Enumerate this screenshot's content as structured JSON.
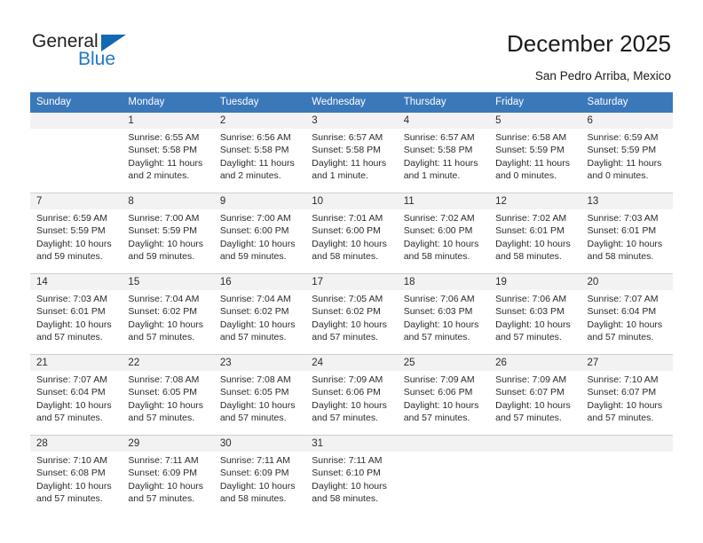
{
  "brand": {
    "word_one": "General",
    "word_two": "Blue",
    "accent_color": "#1268b3",
    "text_color": "#222222"
  },
  "header": {
    "title": "December 2025",
    "location": "San Pedro Arriba, Mexico"
  },
  "calendar": {
    "header_bg": "#3a78ba",
    "header_text_color": "#ffffff",
    "daynum_band_bg": "#f2f2f2",
    "weekday_headers": [
      "Sunday",
      "Monday",
      "Tuesday",
      "Wednesday",
      "Thursday",
      "Friday",
      "Saturday"
    ],
    "weeks": [
      [
        {
          "day": "",
          "sunrise": "",
          "sunset": "",
          "daylight_1": "",
          "daylight_2": ""
        },
        {
          "day": "1",
          "sunrise": "Sunrise: 6:55 AM",
          "sunset": "Sunset: 5:58 PM",
          "daylight_1": "Daylight: 11 hours",
          "daylight_2": "and 2 minutes."
        },
        {
          "day": "2",
          "sunrise": "Sunrise: 6:56 AM",
          "sunset": "Sunset: 5:58 PM",
          "daylight_1": "Daylight: 11 hours",
          "daylight_2": "and 2 minutes."
        },
        {
          "day": "3",
          "sunrise": "Sunrise: 6:57 AM",
          "sunset": "Sunset: 5:58 PM",
          "daylight_1": "Daylight: 11 hours",
          "daylight_2": "and 1 minute."
        },
        {
          "day": "4",
          "sunrise": "Sunrise: 6:57 AM",
          "sunset": "Sunset: 5:58 PM",
          "daylight_1": "Daylight: 11 hours",
          "daylight_2": "and 1 minute."
        },
        {
          "day": "5",
          "sunrise": "Sunrise: 6:58 AM",
          "sunset": "Sunset: 5:59 PM",
          "daylight_1": "Daylight: 11 hours",
          "daylight_2": "and 0 minutes."
        },
        {
          "day": "6",
          "sunrise": "Sunrise: 6:59 AM",
          "sunset": "Sunset: 5:59 PM",
          "daylight_1": "Daylight: 11 hours",
          "daylight_2": "and 0 minutes."
        }
      ],
      [
        {
          "day": "7",
          "sunrise": "Sunrise: 6:59 AM",
          "sunset": "Sunset: 5:59 PM",
          "daylight_1": "Daylight: 10 hours",
          "daylight_2": "and 59 minutes."
        },
        {
          "day": "8",
          "sunrise": "Sunrise: 7:00 AM",
          "sunset": "Sunset: 5:59 PM",
          "daylight_1": "Daylight: 10 hours",
          "daylight_2": "and 59 minutes."
        },
        {
          "day": "9",
          "sunrise": "Sunrise: 7:00 AM",
          "sunset": "Sunset: 6:00 PM",
          "daylight_1": "Daylight: 10 hours",
          "daylight_2": "and 59 minutes."
        },
        {
          "day": "10",
          "sunrise": "Sunrise: 7:01 AM",
          "sunset": "Sunset: 6:00 PM",
          "daylight_1": "Daylight: 10 hours",
          "daylight_2": "and 58 minutes."
        },
        {
          "day": "11",
          "sunrise": "Sunrise: 7:02 AM",
          "sunset": "Sunset: 6:00 PM",
          "daylight_1": "Daylight: 10 hours",
          "daylight_2": "and 58 minutes."
        },
        {
          "day": "12",
          "sunrise": "Sunrise: 7:02 AM",
          "sunset": "Sunset: 6:01 PM",
          "daylight_1": "Daylight: 10 hours",
          "daylight_2": "and 58 minutes."
        },
        {
          "day": "13",
          "sunrise": "Sunrise: 7:03 AM",
          "sunset": "Sunset: 6:01 PM",
          "daylight_1": "Daylight: 10 hours",
          "daylight_2": "and 58 minutes."
        }
      ],
      [
        {
          "day": "14",
          "sunrise": "Sunrise: 7:03 AM",
          "sunset": "Sunset: 6:01 PM",
          "daylight_1": "Daylight: 10 hours",
          "daylight_2": "and 57 minutes."
        },
        {
          "day": "15",
          "sunrise": "Sunrise: 7:04 AM",
          "sunset": "Sunset: 6:02 PM",
          "daylight_1": "Daylight: 10 hours",
          "daylight_2": "and 57 minutes."
        },
        {
          "day": "16",
          "sunrise": "Sunrise: 7:04 AM",
          "sunset": "Sunset: 6:02 PM",
          "daylight_1": "Daylight: 10 hours",
          "daylight_2": "and 57 minutes."
        },
        {
          "day": "17",
          "sunrise": "Sunrise: 7:05 AM",
          "sunset": "Sunset: 6:02 PM",
          "daylight_1": "Daylight: 10 hours",
          "daylight_2": "and 57 minutes."
        },
        {
          "day": "18",
          "sunrise": "Sunrise: 7:06 AM",
          "sunset": "Sunset: 6:03 PM",
          "daylight_1": "Daylight: 10 hours",
          "daylight_2": "and 57 minutes."
        },
        {
          "day": "19",
          "sunrise": "Sunrise: 7:06 AM",
          "sunset": "Sunset: 6:03 PM",
          "daylight_1": "Daylight: 10 hours",
          "daylight_2": "and 57 minutes."
        },
        {
          "day": "20",
          "sunrise": "Sunrise: 7:07 AM",
          "sunset": "Sunset: 6:04 PM",
          "daylight_1": "Daylight: 10 hours",
          "daylight_2": "and 57 minutes."
        }
      ],
      [
        {
          "day": "21",
          "sunrise": "Sunrise: 7:07 AM",
          "sunset": "Sunset: 6:04 PM",
          "daylight_1": "Daylight: 10 hours",
          "daylight_2": "and 57 minutes."
        },
        {
          "day": "22",
          "sunrise": "Sunrise: 7:08 AM",
          "sunset": "Sunset: 6:05 PM",
          "daylight_1": "Daylight: 10 hours",
          "daylight_2": "and 57 minutes."
        },
        {
          "day": "23",
          "sunrise": "Sunrise: 7:08 AM",
          "sunset": "Sunset: 6:05 PM",
          "daylight_1": "Daylight: 10 hours",
          "daylight_2": "and 57 minutes."
        },
        {
          "day": "24",
          "sunrise": "Sunrise: 7:09 AM",
          "sunset": "Sunset: 6:06 PM",
          "daylight_1": "Daylight: 10 hours",
          "daylight_2": "and 57 minutes."
        },
        {
          "day": "25",
          "sunrise": "Sunrise: 7:09 AM",
          "sunset": "Sunset: 6:06 PM",
          "daylight_1": "Daylight: 10 hours",
          "daylight_2": "and 57 minutes."
        },
        {
          "day": "26",
          "sunrise": "Sunrise: 7:09 AM",
          "sunset": "Sunset: 6:07 PM",
          "daylight_1": "Daylight: 10 hours",
          "daylight_2": "and 57 minutes."
        },
        {
          "day": "27",
          "sunrise": "Sunrise: 7:10 AM",
          "sunset": "Sunset: 6:07 PM",
          "daylight_1": "Daylight: 10 hours",
          "daylight_2": "and 57 minutes."
        }
      ],
      [
        {
          "day": "28",
          "sunrise": "Sunrise: 7:10 AM",
          "sunset": "Sunset: 6:08 PM",
          "daylight_1": "Daylight: 10 hours",
          "daylight_2": "and 57 minutes."
        },
        {
          "day": "29",
          "sunrise": "Sunrise: 7:11 AM",
          "sunset": "Sunset: 6:09 PM",
          "daylight_1": "Daylight: 10 hours",
          "daylight_2": "and 57 minutes."
        },
        {
          "day": "30",
          "sunrise": "Sunrise: 7:11 AM",
          "sunset": "Sunset: 6:09 PM",
          "daylight_1": "Daylight: 10 hours",
          "daylight_2": "and 58 minutes."
        },
        {
          "day": "31",
          "sunrise": "Sunrise: 7:11 AM",
          "sunset": "Sunset: 6:10 PM",
          "daylight_1": "Daylight: 10 hours",
          "daylight_2": "and 58 minutes."
        },
        {
          "day": "",
          "sunrise": "",
          "sunset": "",
          "daylight_1": "",
          "daylight_2": ""
        },
        {
          "day": "",
          "sunrise": "",
          "sunset": "",
          "daylight_1": "",
          "daylight_2": ""
        },
        {
          "day": "",
          "sunrise": "",
          "sunset": "",
          "daylight_1": "",
          "daylight_2": ""
        }
      ]
    ]
  }
}
